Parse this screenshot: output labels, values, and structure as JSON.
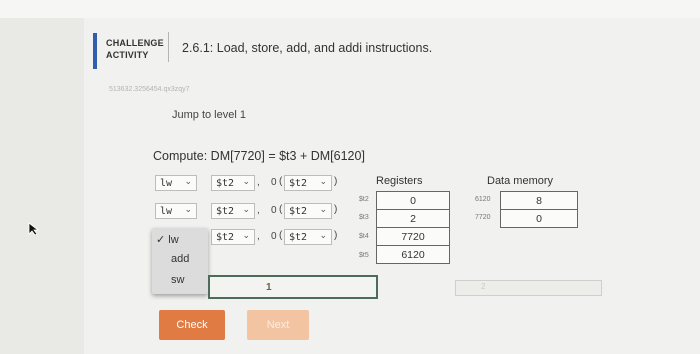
{
  "header": {
    "challenge_label_line1": "CHALLENGE",
    "challenge_label_line2": "ACTIVITY",
    "title": "2.6.1: Load, store, add, and addi instructions.",
    "watermark": "513632.3256454.qx3zqy7"
  },
  "level": {
    "jump_label": "Jump to level 1"
  },
  "compute": {
    "text": "Compute: DM[7720] = $t3 + DM[6120]"
  },
  "instructions": [
    {
      "op": "lw",
      "reg": "$t2",
      "sep": ",",
      "offset": "0",
      "base": "$t2",
      "close": ")"
    },
    {
      "op": "lw",
      "reg": "$t2",
      "sep": ",",
      "offset": "0",
      "base": "$t2",
      "close": ")"
    },
    {
      "op": "",
      "reg": "$t2",
      "sep": ",",
      "offset": "0",
      "base": "$t2",
      "close": ")"
    }
  ],
  "dropdown": {
    "options": [
      "✓ lw",
      "add",
      "sw"
    ]
  },
  "registers": {
    "heading": "Registers",
    "rows": [
      {
        "name": "$t2",
        "value": "0"
      },
      {
        "name": "$t3",
        "value": "2"
      },
      {
        "name": "$t4",
        "value": "7720"
      },
      {
        "name": "$t5",
        "value": "6120"
      }
    ]
  },
  "data_memory": {
    "heading": "Data memory",
    "rows": [
      {
        "address": "6120",
        "value": "8"
      },
      {
        "address": "7720",
        "value": "0"
      }
    ]
  },
  "progress": {
    "current_level": "1",
    "next_level": "2"
  },
  "buttons": {
    "check": "Check",
    "next": "Next"
  },
  "colors": {
    "accent": "#2f5fae",
    "check_button": "#e07b44",
    "next_button_disabled": "#f3c4a2"
  }
}
